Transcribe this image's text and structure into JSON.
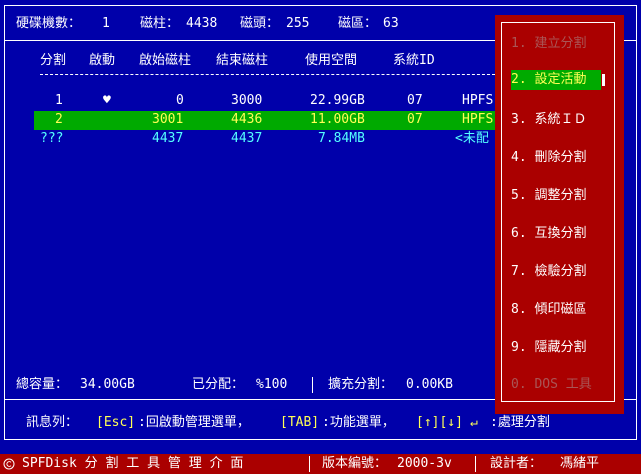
{
  "header": {
    "disk_count_label": "硬碟機數：",
    "disk_count_value": "1",
    "cylinders_label": "磁柱：",
    "cylinders_value": "4438",
    "heads_label": "磁頭：",
    "heads_value": "255",
    "sectors_label": "磁區：",
    "sectors_value": "63"
  },
  "table": {
    "columns": [
      "分割",
      "啟動",
      "啟始磁柱",
      "結束磁柱",
      "使用空間",
      "系統ID"
    ],
    "rows": [
      {
        "part": "1",
        "boot": "♥",
        "start": "0",
        "end": "3000",
        "size": "22.99GB",
        "sysid": "07",
        "type": "HPFS"
      },
      {
        "part": "2",
        "boot": "",
        "start": "3001",
        "end": "4436",
        "size": "11.00GB",
        "sysid": "07",
        "type": "HPFS"
      },
      {
        "part": "???",
        "boot": "",
        "start": "4437",
        "end": "4437",
        "size": "7.84MB",
        "sysid": "",
        "type": "<未配"
      }
    ]
  },
  "menu": {
    "items": [
      {
        "label": "1. 建立分割"
      },
      {
        "label": "2. 設定活動"
      },
      {
        "label": "3. 系統ＩＤ"
      },
      {
        "label": "4. 刪除分割"
      },
      {
        "label": "5. 調整分割"
      },
      {
        "label": "6. 互換分割"
      },
      {
        "label": "7. 檢驗分割"
      },
      {
        "label": "8. 傾印磁區"
      },
      {
        "label": "9. 隱藏分割"
      },
      {
        "label": "0. DOS 工具"
      }
    ]
  },
  "summary": {
    "total_label": "總容量：",
    "total_value": "34.00GB",
    "allocated_label": "已分配：",
    "allocated_value": "%100",
    "extended_label": "擴充分割：",
    "extended_value": "0.00KB"
  },
  "message": {
    "prefix": "訊息列：",
    "esc_key": "[Esc]",
    "esc_text": ":回啟動管理選單，",
    "tab_key": "[TAB]",
    "tab_text": ":功能選單，",
    "arrow_key": "[↑][↓]",
    "enter_key": "↵",
    "enter_text": ":處理分割"
  },
  "status": {
    "app_title": "SPFDisk 分 割 工 具 管 理 介 面",
    "version_label": "版本編號：",
    "version_value": "2000-3v",
    "designer_label": "設計者：",
    "designer_value": "馮緒平"
  },
  "colors": {
    "background": "#0000aa",
    "menu_panel": "#aa0000",
    "highlight": "#00aa00",
    "cyan_text": "#55ffff",
    "key_text": "#ffff55"
  }
}
